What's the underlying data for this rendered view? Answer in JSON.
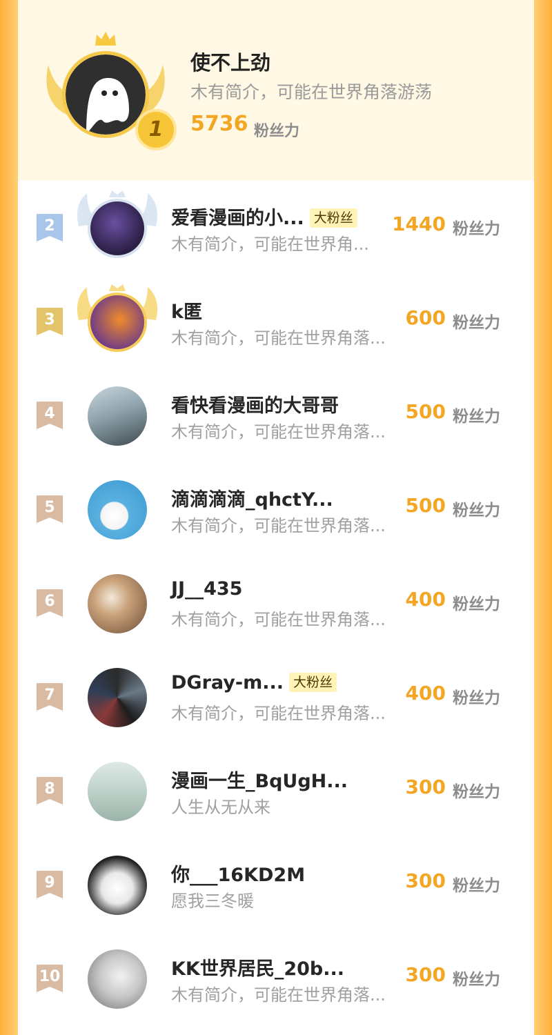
{
  "top": {
    "rank": "1",
    "name": "使不上劲",
    "bio": "木有简介，可能在世界角落游荡",
    "score": "5736",
    "unit": "粉丝力"
  },
  "rows": [
    {
      "rank": "2",
      "name": "爱看漫画的小...",
      "badge": "大粉丝",
      "bio": "木有简介，可能在世界角...",
      "score": "1440",
      "unit": "粉丝力"
    },
    {
      "rank": "3",
      "name": "k匿",
      "badge": "",
      "bio": "木有简介，可能在世界角落...",
      "score": "600",
      "unit": "粉丝力"
    },
    {
      "rank": "4",
      "name": "看快看漫画的大哥哥",
      "badge": "",
      "bio": "木有简介，可能在世界角落...",
      "score": "500",
      "unit": "粉丝力"
    },
    {
      "rank": "5",
      "name": "滴滴滴滴_qhctY...",
      "badge": "",
      "bio": "木有简介，可能在世界角落...",
      "score": "500",
      "unit": "粉丝力"
    },
    {
      "rank": "6",
      "name": "JJ__435",
      "badge": "",
      "bio": "木有简介，可能在世界角落...",
      "score": "400",
      "unit": "粉丝力"
    },
    {
      "rank": "7",
      "name": "DGray-m...",
      "badge": "大粉丝",
      "bio": "木有简介，可能在世界角落...",
      "score": "400",
      "unit": "粉丝力"
    },
    {
      "rank": "8",
      "name": "漫画一生_BqUgH...",
      "badge": "",
      "bio": "人生从无从来",
      "score": "300",
      "unit": "粉丝力"
    },
    {
      "rank": "9",
      "name": "你___16KD2M",
      "badge": "",
      "bio": "愿我三冬暖",
      "score": "300",
      "unit": "粉丝力"
    },
    {
      "rank": "10",
      "name": "KK世界居民_20b...",
      "badge": "",
      "bio": "木有简介，可能在世界角落...",
      "score": "300",
      "unit": "粉丝力"
    }
  ],
  "colors": {
    "accent": "#f3a623",
    "rank2": "#9fc0e6",
    "rank3": "#e2c165",
    "rankOther": "#d8b9a0"
  }
}
